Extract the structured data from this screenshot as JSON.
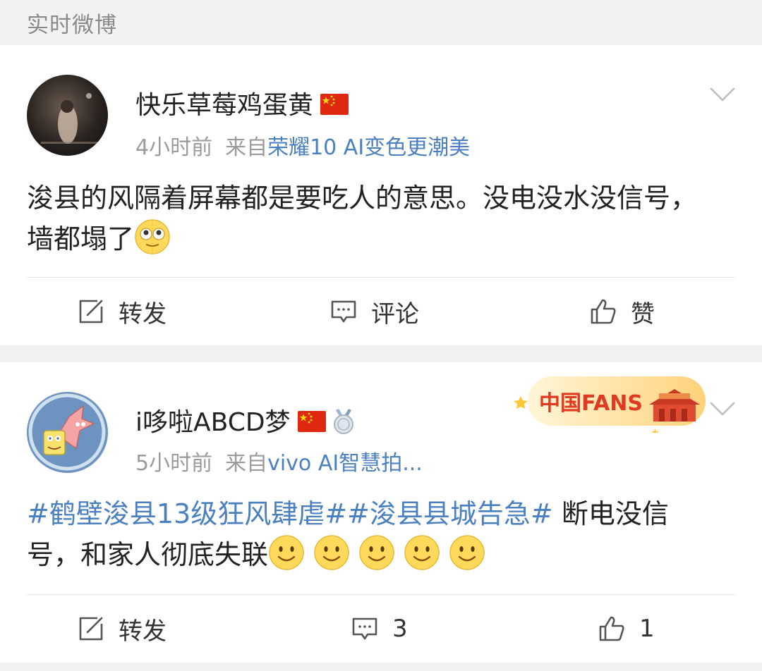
{
  "section_title": "实时微博",
  "posts": [
    {
      "username": "快乐草莓鸡蛋黄",
      "time": "4小时前",
      "from_label": "来自",
      "source": "荣耀10 AI变色更潮美",
      "content": "浚县的风隔着屏幕都是要吃人的意思。没电没水没信号，墙都塌了",
      "repost_label": "转发",
      "comment_label": "评论",
      "like_label": "赞"
    },
    {
      "username": "i哆啦ABCD梦",
      "time": "5小时前",
      "from_label": "来自",
      "source": "vivo AI智慧拍...",
      "hashtag1": "#鹤壁浚县13级狂风肆虐#",
      "hashtag2": "#浚县县城告急#",
      "content": " 断电没信号，和家人彻底失联",
      "repost_label": "转发",
      "comment_count": "3",
      "like_count": "1",
      "badge_text": "中国FANS"
    }
  ],
  "colors": {
    "link_blue": "#4a7fc0",
    "meta_gray": "#9b9b9b",
    "text": "#222222",
    "background": "#f2f2f2"
  },
  "icons": [
    "chevron-down-icon",
    "repost-icon",
    "comment-icon",
    "like-icon",
    "china-flag-icon",
    "medal-icon",
    "emoji-face-icon",
    "smile-emoji-icon"
  ]
}
